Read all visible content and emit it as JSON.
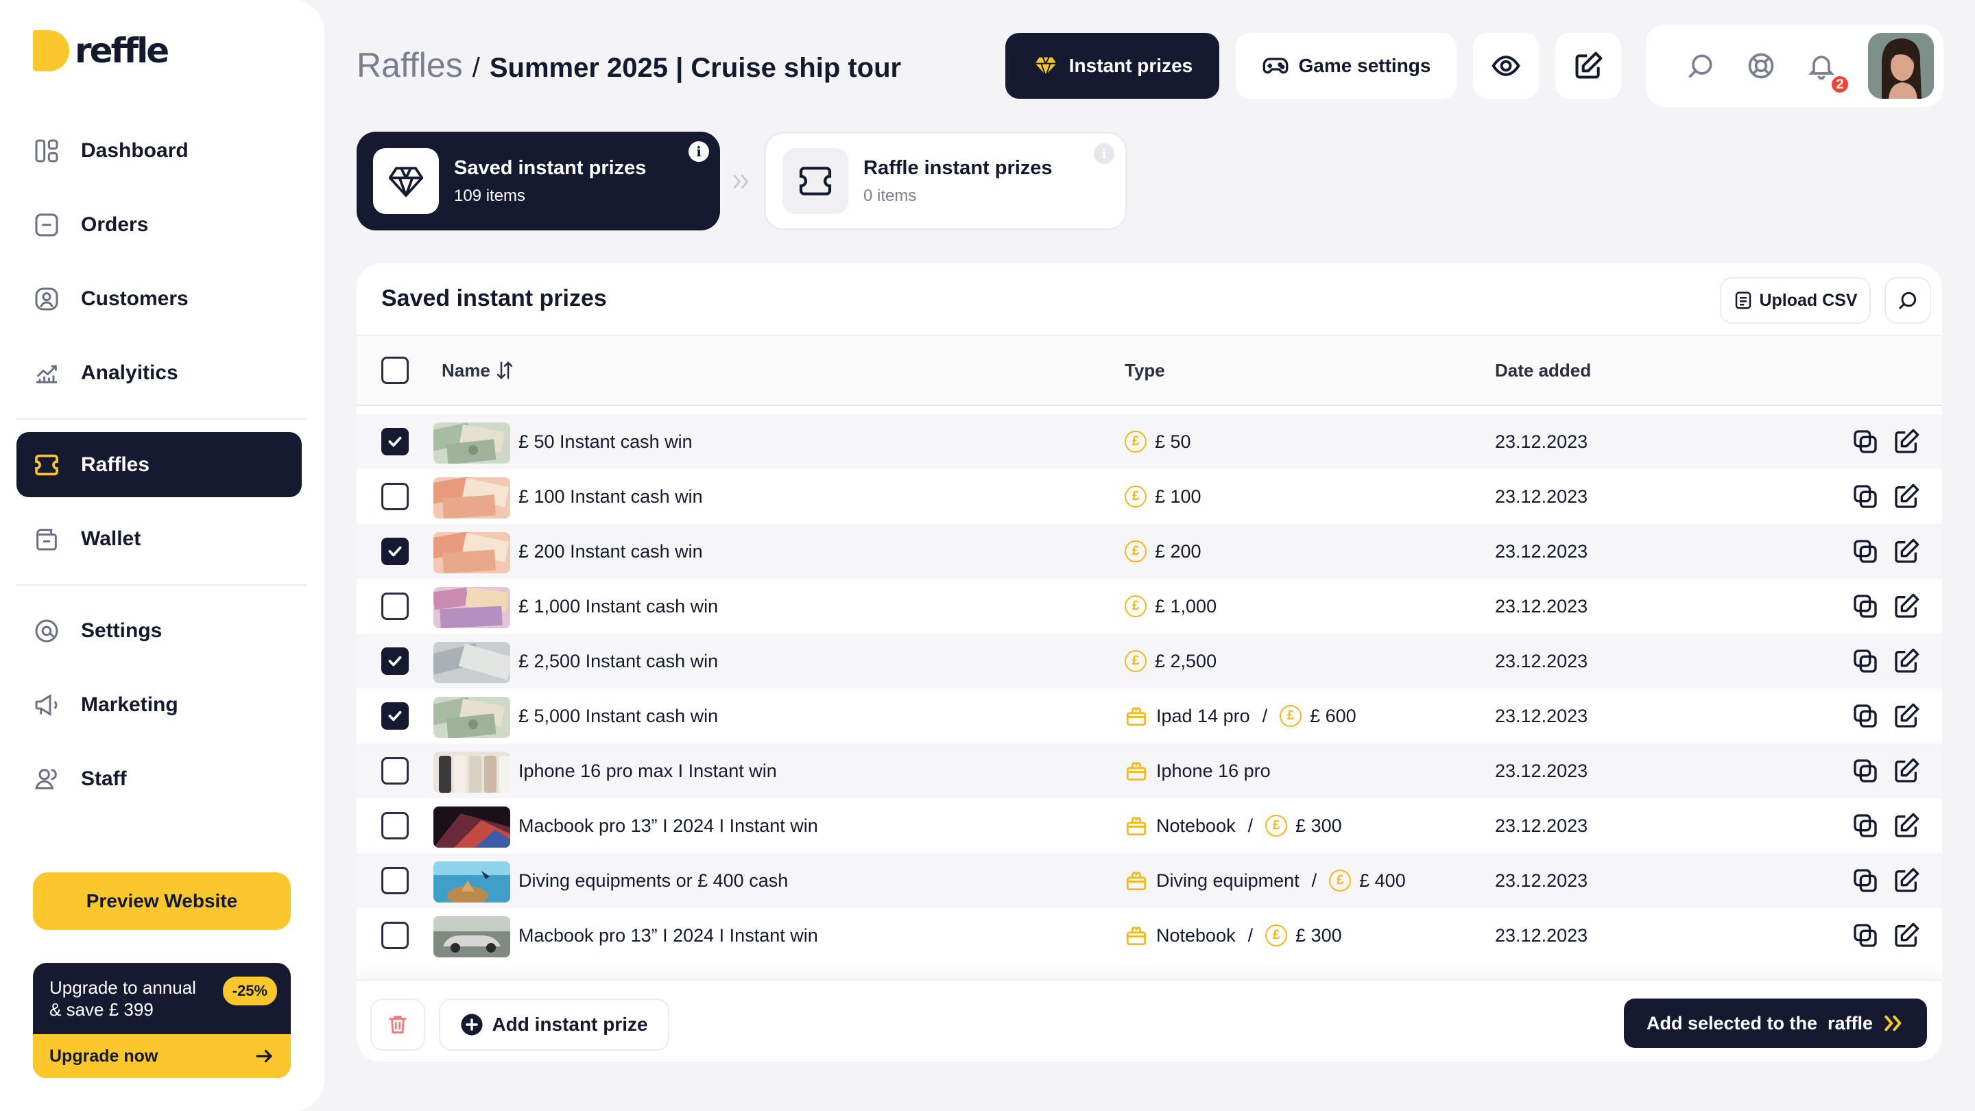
{
  "brand": {
    "name": "reffle",
    "accent": "#fcc62d",
    "dark": "#151a30"
  },
  "sidebar": {
    "items": [
      {
        "label": "Dashboard",
        "icon": "dashboard-icon"
      },
      {
        "label": "Orders",
        "icon": "orders-icon"
      },
      {
        "label": "Customers",
        "icon": "customers-icon"
      },
      {
        "label": "Analyitics",
        "icon": "analytics-icon"
      },
      {
        "label": "Raffles",
        "icon": "raffles-icon",
        "active": true
      },
      {
        "label": "Wallet",
        "icon": "wallet-icon"
      },
      {
        "label": "Settings",
        "icon": "settings-icon"
      },
      {
        "label": "Marketing",
        "icon": "megaphone-icon"
      },
      {
        "label": "Staff",
        "icon": "staff-icon"
      }
    ],
    "preview_label": "Preview Website",
    "upgrade": {
      "line1": "Upgrade to annual",
      "line2": "& save £ 399",
      "discount": "-25%",
      "cta": "Upgrade now"
    }
  },
  "header": {
    "breadcrumb_root": "Raffles",
    "separator": "/",
    "current": "Summer 2025 | Cruise ship tour",
    "instant_prizes_label": "Instant prizes",
    "game_settings_label": "Game settings",
    "notification_count": "2"
  },
  "tabs": {
    "saved": {
      "title": "Saved instant prizes",
      "count": "109 items"
    },
    "raffle": {
      "title": "Raffle instant prizes",
      "count": "0 items"
    }
  },
  "panel": {
    "title": "Saved instant prizes",
    "upload_label": "Upload CSV",
    "columns": {
      "name": "Name",
      "type": "Type",
      "date": "Date added"
    },
    "rows": [
      {
        "checked": true,
        "name": "£ 50 Instant cash win",
        "type": [
          {
            "kind": "coin",
            "text": "£ 50"
          }
        ],
        "date": "23.12.2023",
        "thumb": "cash"
      },
      {
        "checked": false,
        "name": "£ 100 Instant cash win",
        "type": [
          {
            "kind": "coin",
            "text": "£ 100"
          }
        ],
        "date": "23.12.2023",
        "thumb": "cash2"
      },
      {
        "checked": true,
        "name": "£ 200 Instant cash win",
        "type": [
          {
            "kind": "coin",
            "text": "£ 200"
          }
        ],
        "date": "23.12.2023",
        "thumb": "cash2"
      },
      {
        "checked": false,
        "name": "£ 1,000 Instant cash win",
        "type": [
          {
            "kind": "coin",
            "text": "£ 1,000"
          }
        ],
        "date": "23.12.2023",
        "thumb": "cash3"
      },
      {
        "checked": true,
        "name": "£ 2,500 Instant cash win",
        "type": [
          {
            "kind": "coin",
            "text": "£ 2,500"
          }
        ],
        "date": "23.12.2023",
        "thumb": "cash4"
      },
      {
        "checked": true,
        "name": "£ 5,000 Instant cash win",
        "type": [
          {
            "kind": "gift",
            "text": "Ipad 14 pro"
          },
          {
            "kind": "coin",
            "text": "£ 600"
          }
        ],
        "date": "23.12.2023",
        "thumb": "cash"
      },
      {
        "checked": false,
        "name": "Iphone 16 pro max I Instant win",
        "type": [
          {
            "kind": "gift",
            "text": "Iphone 16 pro"
          }
        ],
        "date": "23.12.2023",
        "thumb": "phone"
      },
      {
        "checked": false,
        "name": "Macbook pro 13” I 2024 I Instant win",
        "type": [
          {
            "kind": "gift",
            "text": "Notebook"
          },
          {
            "kind": "coin",
            "text": "£ 300"
          }
        ],
        "date": "23.12.2023",
        "thumb": "mac"
      },
      {
        "checked": false,
        "name": "Diving equipments or £ 400 cash",
        "type": [
          {
            "kind": "gift",
            "text": "Diving equipment"
          },
          {
            "kind": "coin",
            "text": "£ 400"
          }
        ],
        "date": "23.12.2023",
        "thumb": "dive"
      },
      {
        "checked": false,
        "name": "Macbook pro 13” I 2024 I Instant win",
        "type": [
          {
            "kind": "gift",
            "text": "Notebook"
          },
          {
            "kind": "coin",
            "text": "£ 300"
          }
        ],
        "date": "23.12.2023",
        "thumb": "car"
      }
    ],
    "delete_label": "",
    "add_label": "Add instant prize",
    "add_selected_label": "Add selected to the  raffle"
  }
}
